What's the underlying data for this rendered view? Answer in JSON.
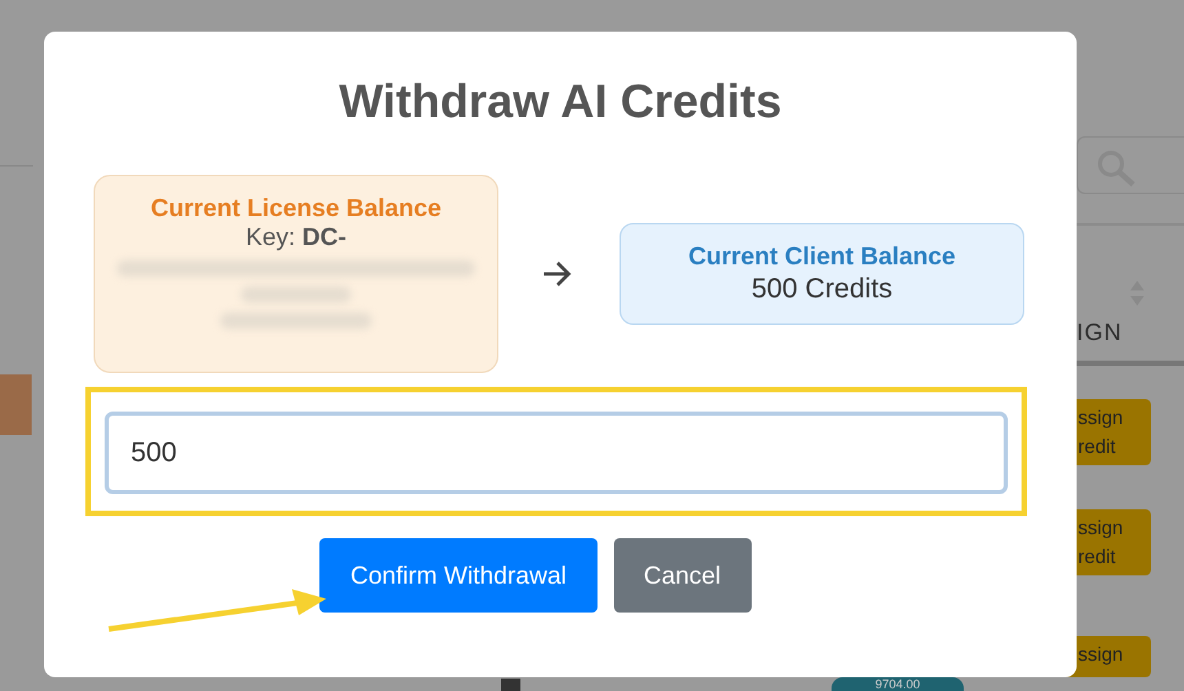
{
  "background": {
    "column_header": "IGN",
    "row_buttons": [
      {
        "lines": [
          "ssign",
          "redit"
        ]
      },
      {
        "lines": [
          "ssign",
          "redit"
        ]
      },
      {
        "lines": [
          "ssign"
        ]
      }
    ],
    "amount_badge": "9704.00"
  },
  "modal": {
    "title": "Withdraw AI Credits",
    "license_balance": {
      "title": "Current License Balance",
      "key_label": "Key: **DC-**"
    },
    "client_balance": {
      "title": "Current Client Balance",
      "amount": "500 Credits"
    },
    "amount_input": {
      "value": "500",
      "highlighted": true
    },
    "buttons": [
      {
        "label": "Confirm Withdrawal",
        "kind": "primary"
      },
      {
        "label": "Cancel",
        "kind": "secondary"
      }
    ]
  }
}
